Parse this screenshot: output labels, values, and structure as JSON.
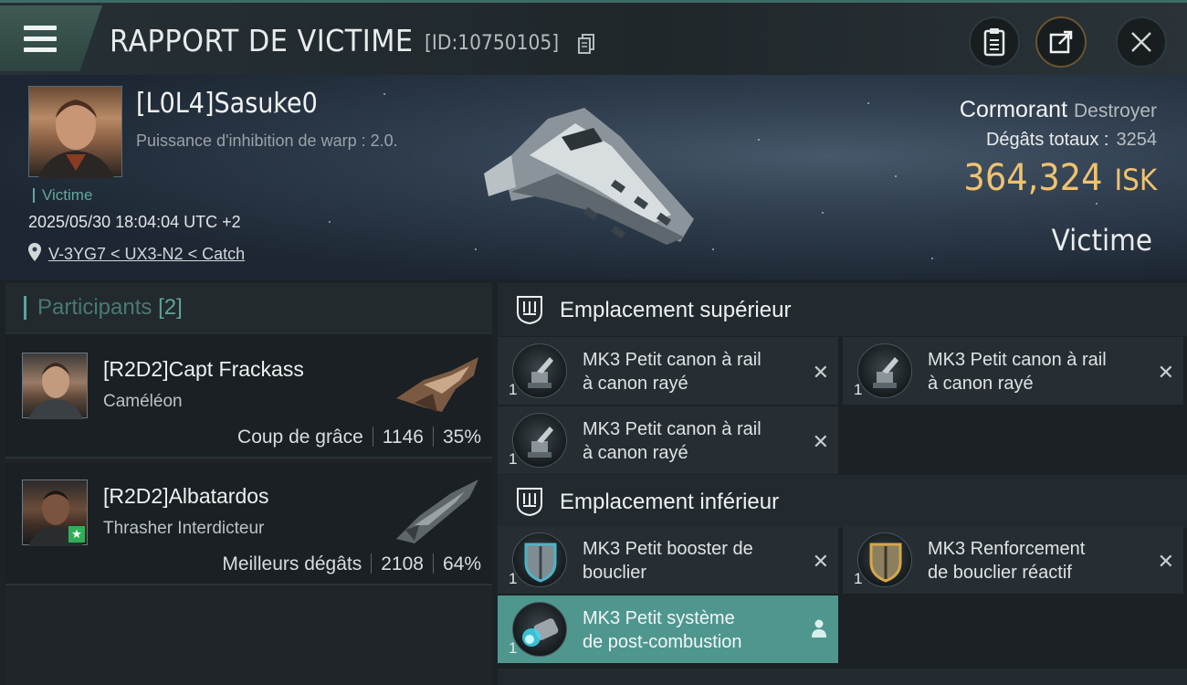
{
  "header": {
    "title": "RAPPORT DE VICTIME",
    "report_id": "[ID:10750105]",
    "icons": [
      "menu-icon",
      "copy-icon",
      "clipboard-icon",
      "share-icon",
      "close-icon"
    ]
  },
  "victim": {
    "name": "[L0L4]Sasuke0",
    "warp_text": "Puissance d'inhibition de warp : 2.0.",
    "tag": "Victime",
    "datetime": "2025/05/30 18:04:04 UTC +2",
    "location": "V-3YG7 < UX3-N2 < Catch",
    "ship_name": "Cormorant",
    "ship_class": "Destroyer",
    "damage_label": "Dégâts totaux :",
    "damage_value": "3254",
    "isk_value": "364,324",
    "isk_unit": "ISK",
    "role_label": "Victime"
  },
  "participants": {
    "title": "Participants",
    "count": "[2]",
    "items": [
      {
        "name": "[R2D2]Capt Frackass",
        "ship": "Caméléon",
        "role": "Coup de grâce",
        "damage": "1146",
        "percent": "35%"
      },
      {
        "name": "[R2D2]Albatardos",
        "ship": "Thrasher Interdicteur",
        "role": "Meilleurs dégâts",
        "damage": "2108",
        "percent": "64%"
      }
    ]
  },
  "fitting": {
    "high_slot_title": "Emplacement supérieur",
    "low_slot_title": "Emplacement inférieur",
    "high_slots": [
      {
        "qty": "1",
        "line1": "MK3 Petit canon à rail",
        "line2": "à canon rayé",
        "status": "destroyed"
      },
      {
        "qty": "1",
        "line1": "MK3 Petit canon à rail",
        "line2": "à canon rayé",
        "status": "destroyed"
      },
      {
        "qty": "1",
        "line1": "MK3 Petit canon à rail",
        "line2": "à canon rayé",
        "status": "destroyed"
      }
    ],
    "low_slots": [
      {
        "qty": "1",
        "line1": "MK3 Petit booster de",
        "line2": "bouclier",
        "status": "destroyed"
      },
      {
        "qty": "1",
        "line1": "MK3 Renforcement",
        "line2": "de bouclier réactif",
        "status": "destroyed"
      },
      {
        "qty": "1",
        "line1": "MK3 Petit système",
        "line2": "de post-combustion",
        "status": "dropped"
      }
    ],
    "destroyed_mark": "✕"
  },
  "colors": {
    "accent": "#5ea39a",
    "isk": "#f0c270",
    "active_slot": "#4f968f",
    "star_badge": "#2fb057"
  }
}
